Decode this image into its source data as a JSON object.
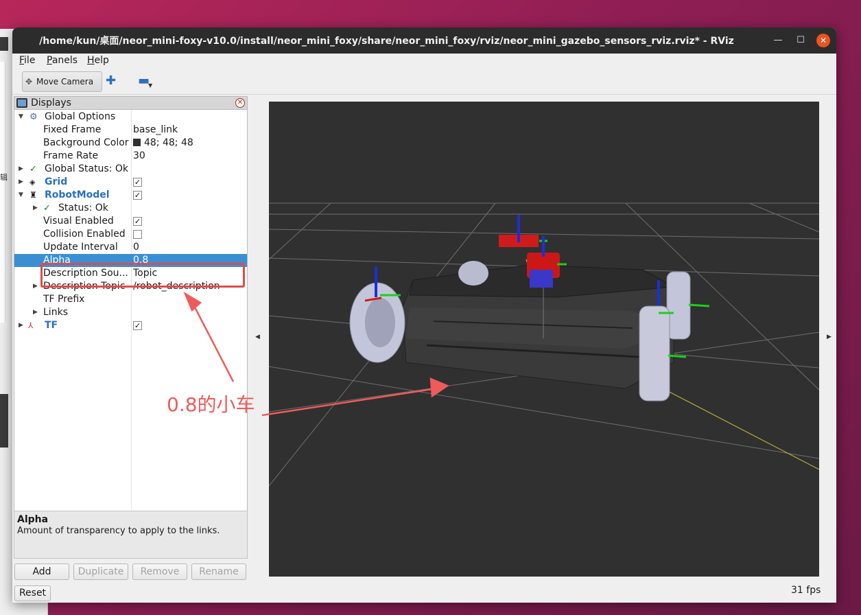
{
  "window": {
    "title": "/home/kun/桌面/neor_mini-foxy-v10.0/install/neor_mini_foxy/share/neor_mini_foxy/rviz/neor_mini_gazebo_sensors_rviz.rviz* - RViz",
    "minimize_glyph": "—",
    "maximize_glyph": "☐",
    "close_glyph": "✕"
  },
  "menu": {
    "file": "File",
    "panels": "Panels",
    "help": "Help"
  },
  "toolbar": {
    "move_camera": "Move Camera",
    "add_glyph": "✚",
    "remove_glyph": "▬"
  },
  "displays": {
    "title": "Displays",
    "rows": [
      {
        "label": "Global Options",
        "value": ""
      },
      {
        "label": "Fixed Frame",
        "value": "base_link"
      },
      {
        "label": "Background Color",
        "value": "48; 48; 48"
      },
      {
        "label": "Frame Rate",
        "value": "30"
      },
      {
        "label": "Global Status: Ok",
        "value": ""
      },
      {
        "label": "Grid",
        "value": "✓"
      },
      {
        "label": "RobotModel",
        "value": "✓"
      },
      {
        "label": "Status: Ok",
        "value": ""
      },
      {
        "label": "Visual Enabled",
        "value": "✓"
      },
      {
        "label": "Collision Enabled",
        "value": ""
      },
      {
        "label": "Update Interval",
        "value": "0"
      },
      {
        "label": "Alpha",
        "value": "0.8"
      },
      {
        "label": "Description Sou...",
        "value": "Topic"
      },
      {
        "label": "Description Topic",
        "value": "/robot_description"
      },
      {
        "label": "TF Prefix",
        "value": ""
      },
      {
        "label": "Links",
        "value": ""
      },
      {
        "label": "TF",
        "value": "✓"
      }
    ]
  },
  "description": {
    "title": "Alpha",
    "text": "Amount of transparency to apply to the links."
  },
  "buttons": {
    "add": "Add",
    "duplicate": "Duplicate",
    "remove": "Remove",
    "rename": "Rename",
    "reset": "Reset"
  },
  "viewport": {
    "fps": "31 fps",
    "background_color": "#303030"
  },
  "annotation": {
    "text": "0.8的小车",
    "color": "#ef5b5b"
  },
  "background_fragment": "辑"
}
